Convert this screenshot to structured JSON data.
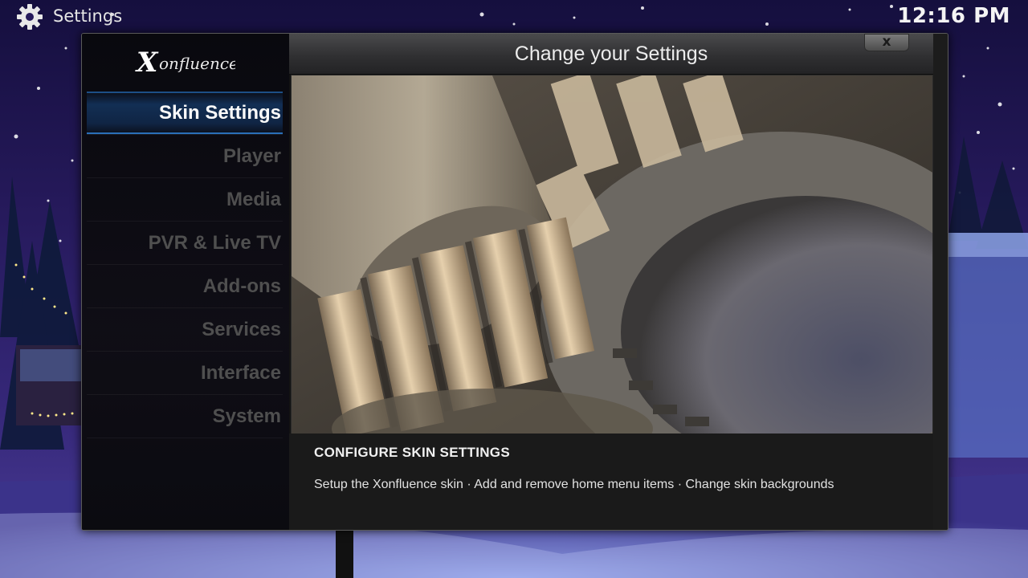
{
  "topbar": {
    "icon": "gear-icon",
    "title": "Settings",
    "clock": "12:16 PM"
  },
  "dialog": {
    "logo_text": "Xonfluence",
    "header_title": "Change your Settings",
    "close_label": "x",
    "nav": [
      {
        "label": "Skin Settings",
        "active": true
      },
      {
        "label": "Player",
        "active": false
      },
      {
        "label": "Media",
        "active": false
      },
      {
        "label": "PVR & Live TV",
        "active": false
      },
      {
        "label": "Add-ons",
        "active": false
      },
      {
        "label": "Services",
        "active": false
      },
      {
        "label": "Interface",
        "active": false
      },
      {
        "label": "System",
        "active": false
      }
    ],
    "info": {
      "title": "CONFIGURE SKIN SETTINGS",
      "description": "Setup the Xonfluence skin · Add and remove home menu items · Change skin backgrounds"
    }
  },
  "colors": {
    "accent": "#2a6fb8",
    "nav_inactive": "#4f4f4f",
    "night_sky": "#25195a"
  }
}
